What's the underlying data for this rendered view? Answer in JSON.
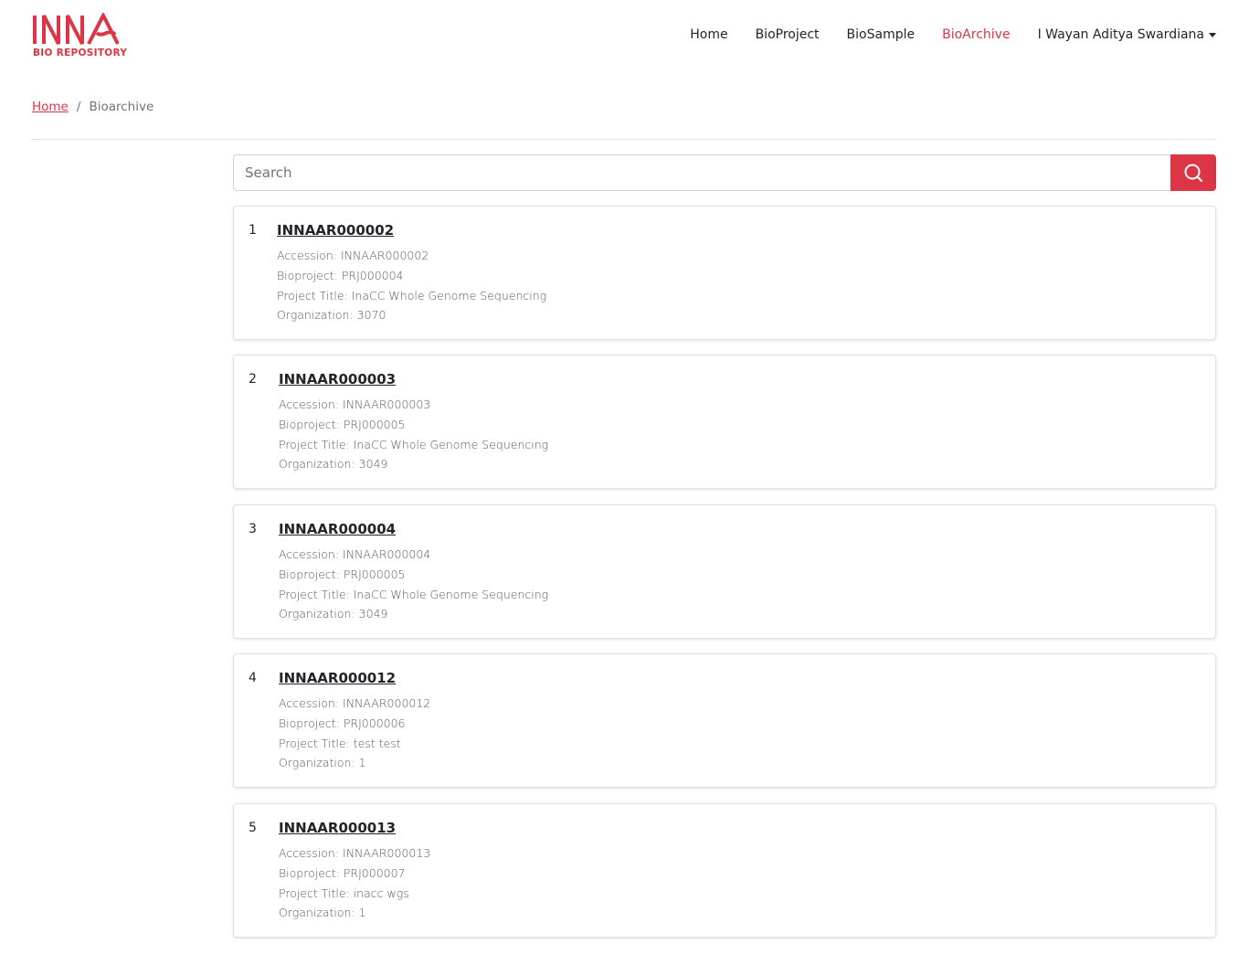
{
  "brand": {
    "name": "INNA",
    "subtitle": "BIO REPOSITORY",
    "color": "#dc3545"
  },
  "nav": {
    "items": [
      {
        "label": "Home",
        "active": false
      },
      {
        "label": "BioProject",
        "active": false
      },
      {
        "label": "BioSample",
        "active": false
      },
      {
        "label": "BioArchive",
        "active": true
      }
    ],
    "user": "I Wayan Aditya Swardiana"
  },
  "breadcrumb": {
    "home": "Home",
    "separator": "/",
    "current": "Bioarchive"
  },
  "search": {
    "placeholder": "Search",
    "value": "",
    "icon": "search-icon"
  },
  "results": [
    {
      "num": "1",
      "title": "INNAAR000002",
      "accession": "Accession: INNAAR000002",
      "bioproject": "Bioproject: PRJ000004",
      "project_title": "Project Title: InaCC Whole Genome Sequencing",
      "organization": "Organization: 3070"
    },
    {
      "num": "2",
      "title": "INNAAR000003",
      "accession": "Accession: INNAAR000003",
      "bioproject": "Bioproject: PRJ000005",
      "project_title": "Project Title: InaCC Whole Genome Sequencing",
      "organization": "Organization: 3049"
    },
    {
      "num": "3",
      "title": "INNAAR000004",
      "accession": "Accession: INNAAR000004",
      "bioproject": "Bioproject: PRJ000005",
      "project_title": "Project Title: InaCC Whole Genome Sequencing",
      "organization": "Organization: 3049"
    },
    {
      "num": "4",
      "title": "INNAAR000012",
      "accession": "Accession: INNAAR000012",
      "bioproject": "Bioproject: PRJ000006",
      "project_title": "Project Title: test test",
      "organization": "Organization: 1"
    },
    {
      "num": "5",
      "title": "INNAAR000013",
      "accession": "Accession: INNAAR000013",
      "bioproject": "Bioproject: PRJ000007",
      "project_title": "Project Title: inacc wgs",
      "organization": "Organization: 1"
    }
  ]
}
